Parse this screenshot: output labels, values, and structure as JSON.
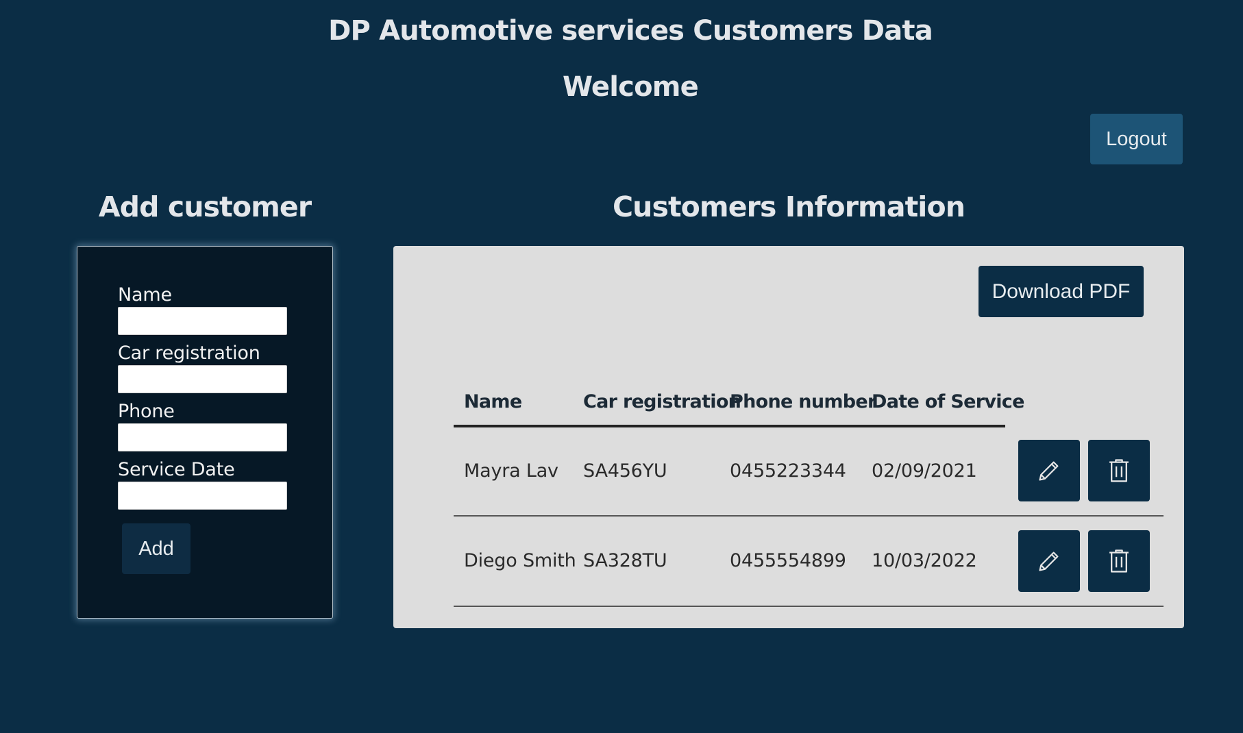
{
  "header": {
    "title": "DP Automotive services Customers Data",
    "welcome": "Welcome",
    "logout_label": "Logout"
  },
  "add_form": {
    "heading": "Add customer",
    "fields": [
      {
        "label": "Name",
        "value": "",
        "placeholder": ""
      },
      {
        "label": "Car registration",
        "value": "",
        "placeholder": ""
      },
      {
        "label": "Phone",
        "value": "",
        "placeholder": ""
      },
      {
        "label": "Service Date",
        "value": "",
        "placeholder": ""
      }
    ],
    "add_label": "Add"
  },
  "customers": {
    "heading": "Customers Information",
    "download_label": "Download PDF",
    "columns": [
      "Name",
      "Car registration",
      "Phone number",
      "Date of Service"
    ],
    "rows": [
      {
        "name": "Mayra Lav",
        "car": "SA456YU",
        "phone": "0455223344",
        "date": "02/09/2021",
        "edit_icon": "pencil-icon",
        "delete_icon": "trash-icon"
      },
      {
        "name": "Diego Smith",
        "car": "SA328TU",
        "phone": "0455554899",
        "date": "10/03/2022",
        "edit_icon": "pencil-icon",
        "delete_icon": "trash-icon"
      }
    ]
  },
  "colors": {
    "background": "#0b2d45",
    "panel": "#dddddd",
    "form_panel": "#061826",
    "logout_button": "#1d5476",
    "action_button": "#0b2d45"
  }
}
